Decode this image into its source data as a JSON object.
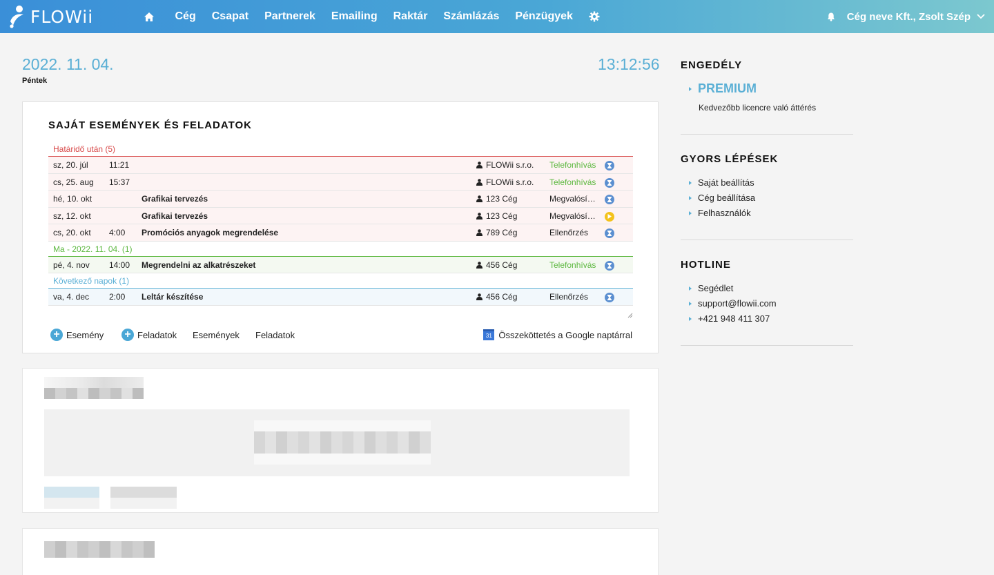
{
  "brand": {
    "name": "FLOWii"
  },
  "nav": {
    "items": [
      "Cég",
      "Csapat",
      "Partnerek",
      "Emailing",
      "Raktár",
      "Számlázás",
      "Pénzügyek"
    ]
  },
  "user": {
    "label": "Cég neve Kft., Zsolt Szép"
  },
  "header": {
    "date": "2022. 11. 04.",
    "weekday": "Péntek",
    "time": "13:12:56"
  },
  "events_card": {
    "title": "SAJÁT ESEMÉNYEK ÉS FELADATOK",
    "groups": {
      "overdue": "Határidő után (5)",
      "today": "Ma - 2022. 11. 04. (1)",
      "upcoming": "Következő napok (1)"
    },
    "rows": [
      {
        "date": "sz, 20. júl",
        "time": "11:21",
        "title": "",
        "person": "FLOWii s.r.o.",
        "type": "Telefonhívás",
        "status": "blue"
      },
      {
        "date": "cs, 25. aug",
        "time": "15:37",
        "title": "",
        "person": "FLOWii s.r.o.",
        "type": "Telefonhívás",
        "status": "blue"
      },
      {
        "date": "hé, 10. okt",
        "time": "",
        "title": "Grafikai tervezés",
        "person": "123 Cég",
        "type": "Megvalósítás",
        "status": "blue"
      },
      {
        "date": "sz, 12. okt",
        "time": "",
        "title": "Grafikai tervezés",
        "person": "123 Cég",
        "type": "Megvalósítás",
        "status": "yellow"
      },
      {
        "date": "cs, 20. okt",
        "time": "4:00",
        "title": "Promóciós anyagok megrendelése",
        "person": "789 Cég",
        "type": "Ellenőrzés",
        "status": "blue"
      },
      {
        "date": "pé, 4. nov",
        "time": "14:00",
        "title": "Megrendelni az alkatrészeket",
        "person": "456 Cég",
        "type": "Telefonhívás",
        "status": "blue"
      },
      {
        "date": "va, 4. dec",
        "time": "2:00",
        "title": "Leltár készítése",
        "person": "456 Cég",
        "type": "Ellenőrzés",
        "status": "blue"
      }
    ],
    "actions": {
      "add_event": "Esemény",
      "add_task": "Feladatok",
      "events": "Események",
      "tasks": "Feladatok",
      "google": "Összeköttetés a Google naptárral"
    }
  },
  "sidebar": {
    "license": {
      "heading": "ENGEDÉLY",
      "plan": "PREMIUM",
      "subtitle": "Kedvezőbb licencre való áttérés"
    },
    "quick": {
      "heading": "GYORS LÉPÉSEK",
      "items": [
        "Saját beállítás",
        "Cég beállítása",
        "Felhasználók"
      ]
    },
    "hotline": {
      "heading": "HOTLINE",
      "items": [
        "Segédlet",
        "support@flowii.com",
        "+421 948 411 307"
      ]
    }
  },
  "colors": {
    "accent": "#5aafd5",
    "overdue": "#d84a4a",
    "today": "#5db840",
    "status_blue": "#5b8fd0",
    "status_yellow": "#f3c21a"
  }
}
